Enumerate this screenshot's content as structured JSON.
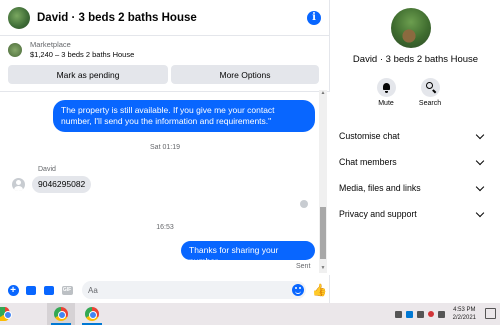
{
  "header": {
    "title": "David · 3 beds 2 baths House",
    "info_icon": "info-icon"
  },
  "listing": {
    "label": "Marketplace",
    "price_title": "$1,240 – 3 beds 2 baths House",
    "mark_pending": "Mark as pending",
    "more_options": "More Options"
  },
  "messages": {
    "outgoing_1": "The property is still available. If you give me your contact number, I'll send you the information and requirements.\"",
    "timestamp_1": "Sat 01:19",
    "sender_name": "David",
    "incoming_1": "9046295082",
    "timestamp_2": "16:53",
    "outgoing_2": "Thanks for sharing your number.",
    "sent_status": "Sent"
  },
  "composer": {
    "placeholder": "Aa",
    "gif_label": "GIF"
  },
  "sidebar": {
    "name": "David · 3 beds 2 baths House",
    "mute_label": "Mute",
    "search_label": "Search",
    "menu": [
      {
        "label": "Customise chat"
      },
      {
        "label": "Chat members"
      },
      {
        "label": "Media, files and links"
      },
      {
        "label": "Privacy and support"
      }
    ]
  },
  "taskbar": {
    "time": "4:53 PM",
    "date": "2/2/2021"
  },
  "colors": {
    "accent": "#0866ff",
    "bubble_in": "#e4e6eb",
    "button_bg": "#e4e6eb"
  }
}
